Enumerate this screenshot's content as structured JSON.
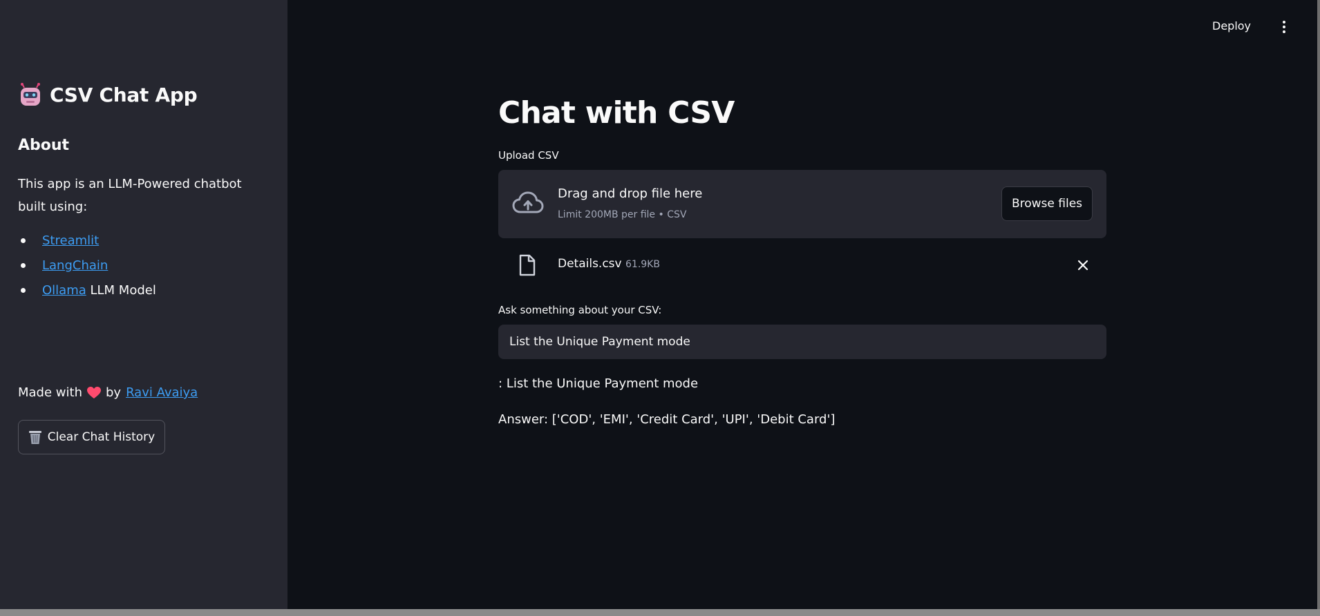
{
  "sidebar": {
    "title": "CSV Chat App",
    "about_heading": "About",
    "description": "This app is an LLM-Powered chatbot built using:",
    "items": [
      {
        "link": "Streamlit",
        "suffix": ""
      },
      {
        "link": "LangChain",
        "suffix": ""
      },
      {
        "link": "Ollama",
        "suffix": " LLM Model"
      }
    ],
    "made_with_prefix": "Made with",
    "made_with_by": "by",
    "author": "Ravi Avaiya",
    "clear_button": "Clear Chat History"
  },
  "header": {
    "deploy": "Deploy"
  },
  "main": {
    "title": "Chat with CSV",
    "upload_label": "Upload CSV",
    "dropzone_main": "Drag and drop file here",
    "dropzone_sub": "Limit 200MB per file • CSV",
    "browse_button": "Browse files",
    "file_name": "Details.csv",
    "file_size": "61.9KB",
    "ask_label": "Ask something about your CSV:",
    "ask_value": "List the Unique Payment mode",
    "question_line": ": List the Unique Payment mode",
    "answer_line": "Answer: ['COD', 'EMI', 'Credit Card', 'UPI', 'Debit Card']"
  },
  "icons": {
    "robot": "robot-icon",
    "heart": "heart-icon",
    "trash": "wastebasket-icon",
    "cloud": "cloud-upload-icon",
    "file": "file-icon",
    "close": "close-icon",
    "menu": "kebab-menu-icon"
  },
  "colors": {
    "background": "#0e1117",
    "sidebar": "#262730",
    "link": "#3d9df3",
    "heart": "#ff4b6e"
  }
}
